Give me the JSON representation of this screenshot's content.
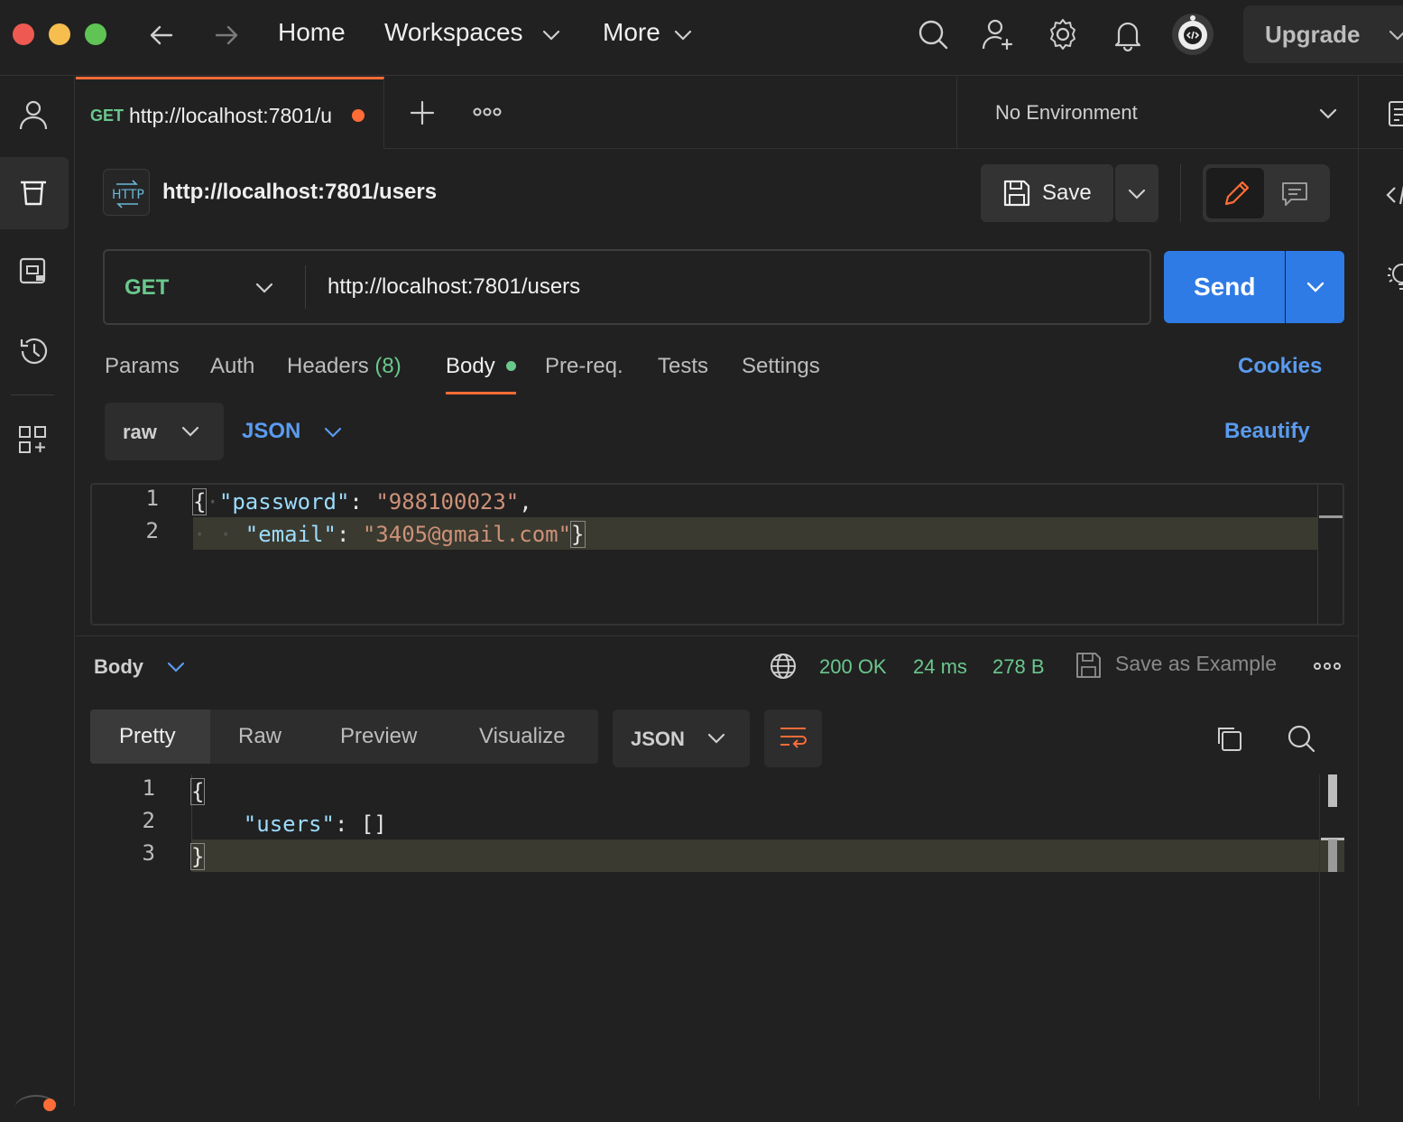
{
  "topbar": {
    "home": "Home",
    "workspaces": "Workspaces",
    "more": "More",
    "upgrade": "Upgrade"
  },
  "tab": {
    "method": "GET",
    "url": "http://localhost:7801/u"
  },
  "environment": "No Environment",
  "request": {
    "title": "http://localhost:7801/users",
    "save_label": "Save",
    "method": "GET",
    "url": "http://localhost:7801/users",
    "send_label": "Send"
  },
  "request_tabs": {
    "params": "Params",
    "auth": "Auth",
    "headers": "Headers",
    "headers_count": "(8)",
    "body": "Body",
    "prereq": "Pre-req.",
    "tests": "Tests",
    "settings": "Settings",
    "cookies": "Cookies"
  },
  "body_options": {
    "mode": "raw",
    "format": "JSON",
    "beautify": "Beautify"
  },
  "request_body": {
    "line_numbers": [
      "1",
      "2"
    ],
    "line1": {
      "open": "{",
      "key": "\"password\"",
      "colon": ": ",
      "value": "\"988100023\"",
      "comma": ","
    },
    "line2": {
      "key": "\"email\"",
      "colon": ": ",
      "value": "\"3405@gmail.com\"",
      "close": "}"
    }
  },
  "response": {
    "body_label": "Body",
    "status": "200 OK",
    "time": "24 ms",
    "size": "278 B",
    "save_example": "Save as Example",
    "view_tabs": [
      "Pretty",
      "Raw",
      "Preview",
      "Visualize"
    ],
    "format": "JSON",
    "line_numbers": [
      "1",
      "2",
      "3"
    ],
    "line1": "{",
    "line2_key": "\"users\"",
    "line2_rest": ": []",
    "line3": "}"
  }
}
